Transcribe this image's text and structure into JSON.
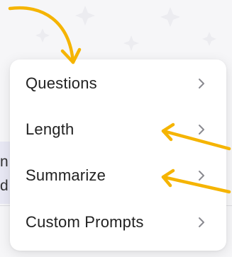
{
  "menu": {
    "items": [
      {
        "label": "Questions",
        "icon": "chevron-right-icon"
      },
      {
        "label": "Length",
        "icon": "chevron-right-icon"
      },
      {
        "label": "Summarize",
        "icon": "chevron-right-icon"
      },
      {
        "label": "Custom Prompts",
        "icon": "chevron-right-icon"
      }
    ]
  },
  "background": {
    "left_text": [
      "n",
      "d"
    ]
  },
  "colors": {
    "annotation_arrow": "#f5b400",
    "menu_text": "#222222",
    "chevron": "#8a8a90",
    "menu_background": "#ffffff",
    "page_background": "#f6f6f8"
  }
}
